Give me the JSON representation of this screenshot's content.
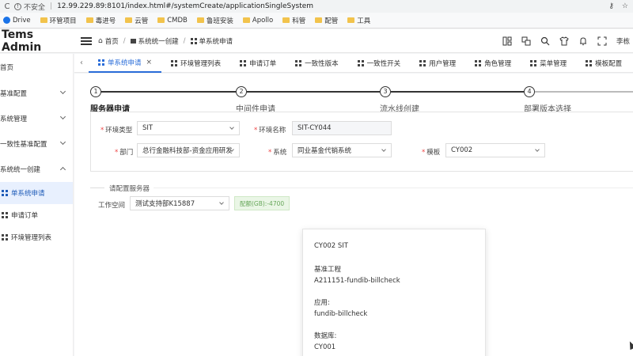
{
  "browser": {
    "insecure_label": "不安全",
    "url": "12.99.229.89:8101/index.html#/systemCreate/applicationSingleSystem",
    "bookmarks": [
      "Drive",
      "环管项目",
      "毒进号",
      "云管",
      "CMDB",
      "鲁班安装",
      "Apollo",
      "科管",
      "配管",
      "工具"
    ]
  },
  "app": {
    "brand": "Tems Admin",
    "breadcrumbs": [
      "首页",
      "系统统一创建",
      "单系统申请"
    ],
    "user_name": "李栋"
  },
  "sidebar": {
    "items": [
      {
        "label": "首页"
      },
      {
        "label": "基准配置"
      },
      {
        "label": "系统管理"
      },
      {
        "label": "一致性基准配置"
      },
      {
        "label": "系统统一创建"
      }
    ],
    "sub_items": [
      {
        "label": "单系统申请"
      },
      {
        "label": "申请订单"
      },
      {
        "label": "环境管理列表"
      }
    ]
  },
  "tabs": [
    "单系统申请",
    "环境管理列表",
    "申请订单",
    "一致性版本",
    "一致性开关",
    "用户管理",
    "角色管理",
    "菜单管理",
    "模板配置"
  ],
  "steps": [
    {
      "num": "1",
      "label": "服务器申请"
    },
    {
      "num": "2",
      "label": "中间件申请"
    },
    {
      "num": "3",
      "label": "流水线创建"
    },
    {
      "num": "4",
      "label": "部署版本选择"
    }
  ],
  "form": {
    "env_type_label": "环境类型",
    "env_type_value": "SIT",
    "env_name_label": "环境名称",
    "env_name_value": "SIT-CY044",
    "dept_label": "部门",
    "dept_value": "总行金融科技部-资金应用研发",
    "system_label": "系统",
    "system_value": "同业基金代销系统",
    "template_label": "模板",
    "template_value": "CY002"
  },
  "server_section": {
    "title": "请配置服务器",
    "workspace_label": "工作空间",
    "workspace_value": "测试支持部K15887",
    "quota": "配额(GB):-4700"
  },
  "popup": {
    "line1": "CY002   SIT",
    "base_label": "基准工程",
    "base_value": "A211151-fundib-billcheck",
    "app_label": "应用:",
    "app_value": "fundib-billcheck",
    "db_label": "数据库:",
    "db_value": "CY001"
  },
  "colors": {
    "accent": "#2a6dd9",
    "quota_green": "#67a75a"
  }
}
